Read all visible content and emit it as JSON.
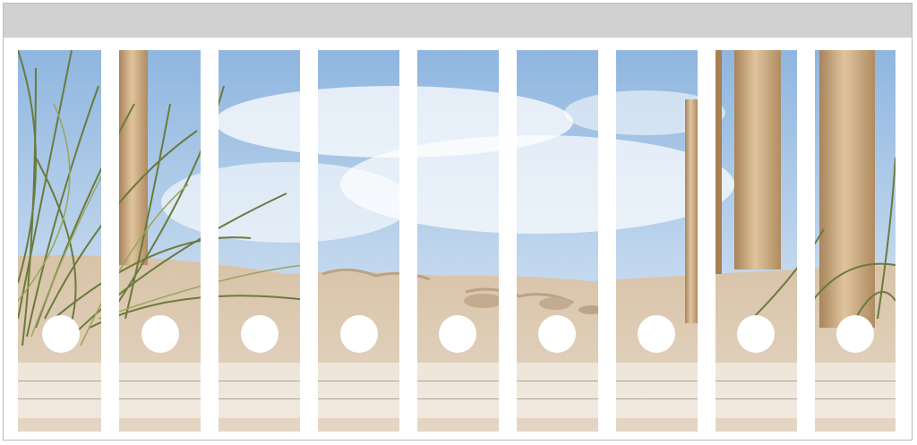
{
  "sheet": {
    "spine_count": 9,
    "colors": {
      "header_band": "#d1d1d1",
      "sky": "#a9c8e8",
      "sand": "#d9c6ae",
      "grass": "#6b7a3c",
      "post_wood": "#c9a67a"
    }
  },
  "spines": [
    {
      "id": "spine-1"
    },
    {
      "id": "spine-2"
    },
    {
      "id": "spine-3"
    },
    {
      "id": "spine-4"
    },
    {
      "id": "spine-5"
    },
    {
      "id": "spine-6"
    },
    {
      "id": "spine-7"
    },
    {
      "id": "spine-8"
    },
    {
      "id": "spine-9"
    }
  ]
}
